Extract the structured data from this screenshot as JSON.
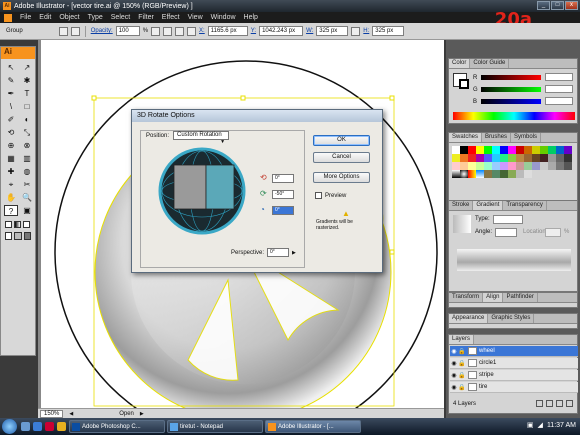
{
  "window": {
    "title": "Adobe Illustrator - [vector tire.ai @ 150% (RGB/Preview) ]",
    "app_badge": "Ai",
    "controls": [
      "_",
      "□",
      "x"
    ]
  },
  "menubar": [
    "File",
    "Edit",
    "Object",
    "Type",
    "Select",
    "Filter",
    "Effect",
    "View",
    "Window",
    "Help"
  ],
  "step_label": "20a",
  "control_bar": {
    "group_label": "Group",
    "opacity_label": "Opacity:",
    "opacity_value": "100",
    "percent": "%",
    "x_label": "X:",
    "x_value": "1165.6 px",
    "y_label": "Y:",
    "y_value": "1042.243 px",
    "w_label": "W:",
    "w_value": "325 px",
    "h_label": "H:",
    "h_value": "325 px"
  },
  "toolbox": {
    "badge": "Ai",
    "tools": [
      "↖",
      "↗",
      "✎",
      "✱",
      "✒",
      "T",
      "\\",
      "□",
      "✐",
      "◐",
      "⟲",
      "⤡",
      "⊕",
      "⊗",
      "▦",
      "▥",
      "✚",
      "◍",
      "⌖",
      "✂",
      "✋",
      "🔍",
      "?",
      "▣"
    ]
  },
  "status_bar": {
    "zoom": "150%",
    "state": "Open"
  },
  "dialog": {
    "title": "3D Rotate Options",
    "position_label": "Position:",
    "position_value": "Custom Rotation",
    "x_rotation": "0°",
    "y_rotation": "-50°",
    "z_rotation": "0°",
    "perspective_label": "Perspective:",
    "perspective_value": "0°",
    "buttons": {
      "ok": "OK",
      "cancel": "Cancel",
      "more_options": "More Options"
    },
    "preview_label": "Preview",
    "warning_text": "Gradients will be rasterized."
  },
  "panels": {
    "color": {
      "tabs": [
        "Color",
        "Color Guide"
      ],
      "channels": [
        "R",
        "G",
        "B"
      ]
    },
    "swatches": {
      "tabs": [
        "Swatches",
        "Brushes",
        "Symbols"
      ]
    },
    "gradient": {
      "tabs": [
        "Stroke",
        "Gradient",
        "Transparency"
      ],
      "type_label": "Type:",
      "angle_label": "Angle:",
      "location_label": "Location:",
      "percent": "%"
    },
    "transform": {
      "tabs": [
        "Transform",
        "Align",
        "Pathfinder"
      ]
    },
    "appearance": {
      "tabs": [
        "Appearance",
        "Graphic Styles"
      ]
    },
    "layers": {
      "tabs": [
        "Layers"
      ],
      "rows": [
        "wheel",
        "circle1",
        "stripe",
        "tire"
      ],
      "footer": "4 Layers"
    }
  },
  "taskbar": {
    "tasks": [
      {
        "label": "Adobe Photoshop C...",
        "color": "#0a4da2"
      },
      {
        "label": "tiretut - Notepad",
        "color": "#5aa5e8"
      },
      {
        "label": "Adobe Illustrator - [...",
        "color": "#f7931e"
      }
    ],
    "clock": "11:37 AM"
  },
  "colors": {
    "accent_orange": "#f7931e",
    "selection_yellow": "#e8e000",
    "step_red": "#e2231a",
    "preview_teal": "#5ba8b8"
  }
}
